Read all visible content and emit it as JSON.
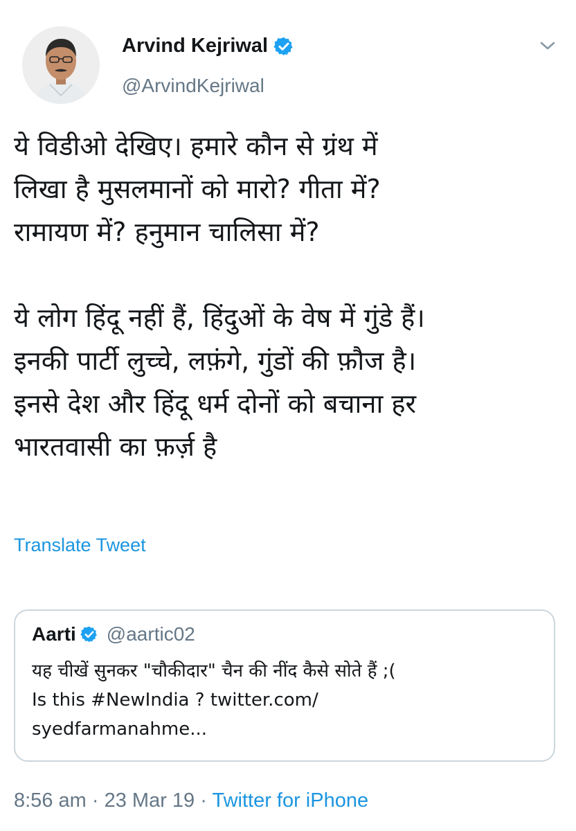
{
  "author": {
    "name": "Arvind Kejriwal",
    "handle": "@ArvindKejriwal",
    "verified": true
  },
  "tweet": {
    "paragraphs": [
      {
        "lines": [
          "ये विडीओ देखिए। हमारे कौन से ग्रंथ में",
          "लिखा है मुसलमानों को मारो? गीता में?",
          "रामायण में? हनुमान चालिसा में?"
        ]
      },
      {
        "lines": [
          "ये लोग हिंदू नहीं हैं, हिंदुओं के वेष में गुंडे हैं।",
          "इनकी पार्टी लुच्चे, लफ़ंगे, गुंडों की फ़ौज है।",
          "इनसे देश और हिंदू धर्म दोनों को बचाना हर",
          "भारतवासी का फ़र्ज़ है"
        ]
      }
    ],
    "translate_label": "Translate Tweet"
  },
  "quoted": {
    "name": "Aarti",
    "handle": "@aartic02",
    "verified": true,
    "lines": [
      "यह चीखें सुनकर \"चौकीदार\" चैन की नींद कैसे सोते हैं ;(",
      "Is this #NewIndia ? twitter.com/",
      "syedfarmanahme..."
    ]
  },
  "meta": {
    "time": "8:56 am",
    "separator": "·",
    "date": "23 Mar 19",
    "source": "Twitter for iPhone"
  },
  "colors": {
    "link": "#1b95e0",
    "verified": "#1da1f2",
    "secondary_text": "#657786",
    "border": "#ccd6dd"
  },
  "icons": [
    "verified-badge-icon",
    "chevron-down-icon"
  ]
}
